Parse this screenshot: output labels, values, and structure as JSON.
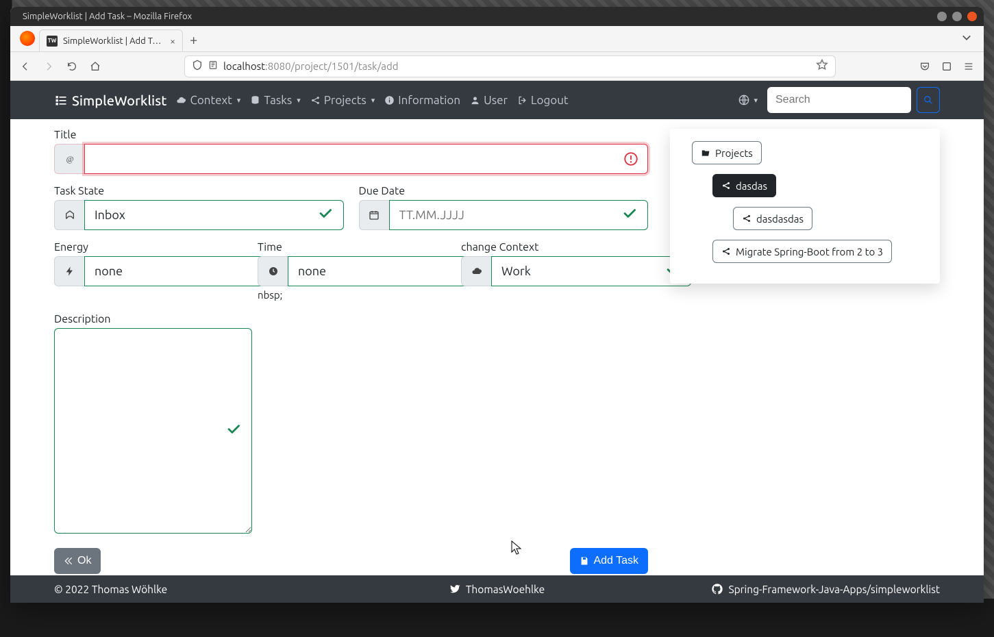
{
  "window": {
    "title": "SimpleWorklist | Add Task – Mozilla Firefox"
  },
  "tab": {
    "title": "SimpleWorklist | Add Task",
    "favicon_text": "TW"
  },
  "urlbar": {
    "host": "localhost",
    "rest": ":8080/project/1501/task/add"
  },
  "navbar": {
    "brand": "SimpleWorklist",
    "context": "Context",
    "tasks": "Tasks",
    "projects": "Projects",
    "information": "Information",
    "user": "User",
    "logout": "Logout",
    "search_placeholder": "Search"
  },
  "form": {
    "title_label": "Title",
    "title_value": "",
    "task_state_label": "Task State",
    "task_state_value": "Inbox",
    "due_date_label": "Due Date",
    "due_date_placeholder": "TT.MM.JJJJ",
    "energy_label": "Energy",
    "energy_value": "none",
    "time_label": "Time",
    "time_value": "none",
    "time_help": "nbsp;",
    "context_label": "change Context",
    "context_value": "Work",
    "description_label": "Description",
    "description_value": "",
    "ok_label": "Ok",
    "submit_label": "Add Task"
  },
  "side": {
    "root_label": "Projects",
    "nodes": [
      {
        "label": "dasdas",
        "selected": true,
        "depth": 1
      },
      {
        "label": "dasdasdas",
        "selected": false,
        "depth": 2
      },
      {
        "label": "Migrate Spring-Boot from 2 to 3",
        "selected": false,
        "depth": 1
      }
    ]
  },
  "footer": {
    "left": "© 2022 Thomas Wöhlke",
    "center": "ThomasWoehlke",
    "right": "Spring-Framework-Java-Apps/simpleworklist"
  }
}
